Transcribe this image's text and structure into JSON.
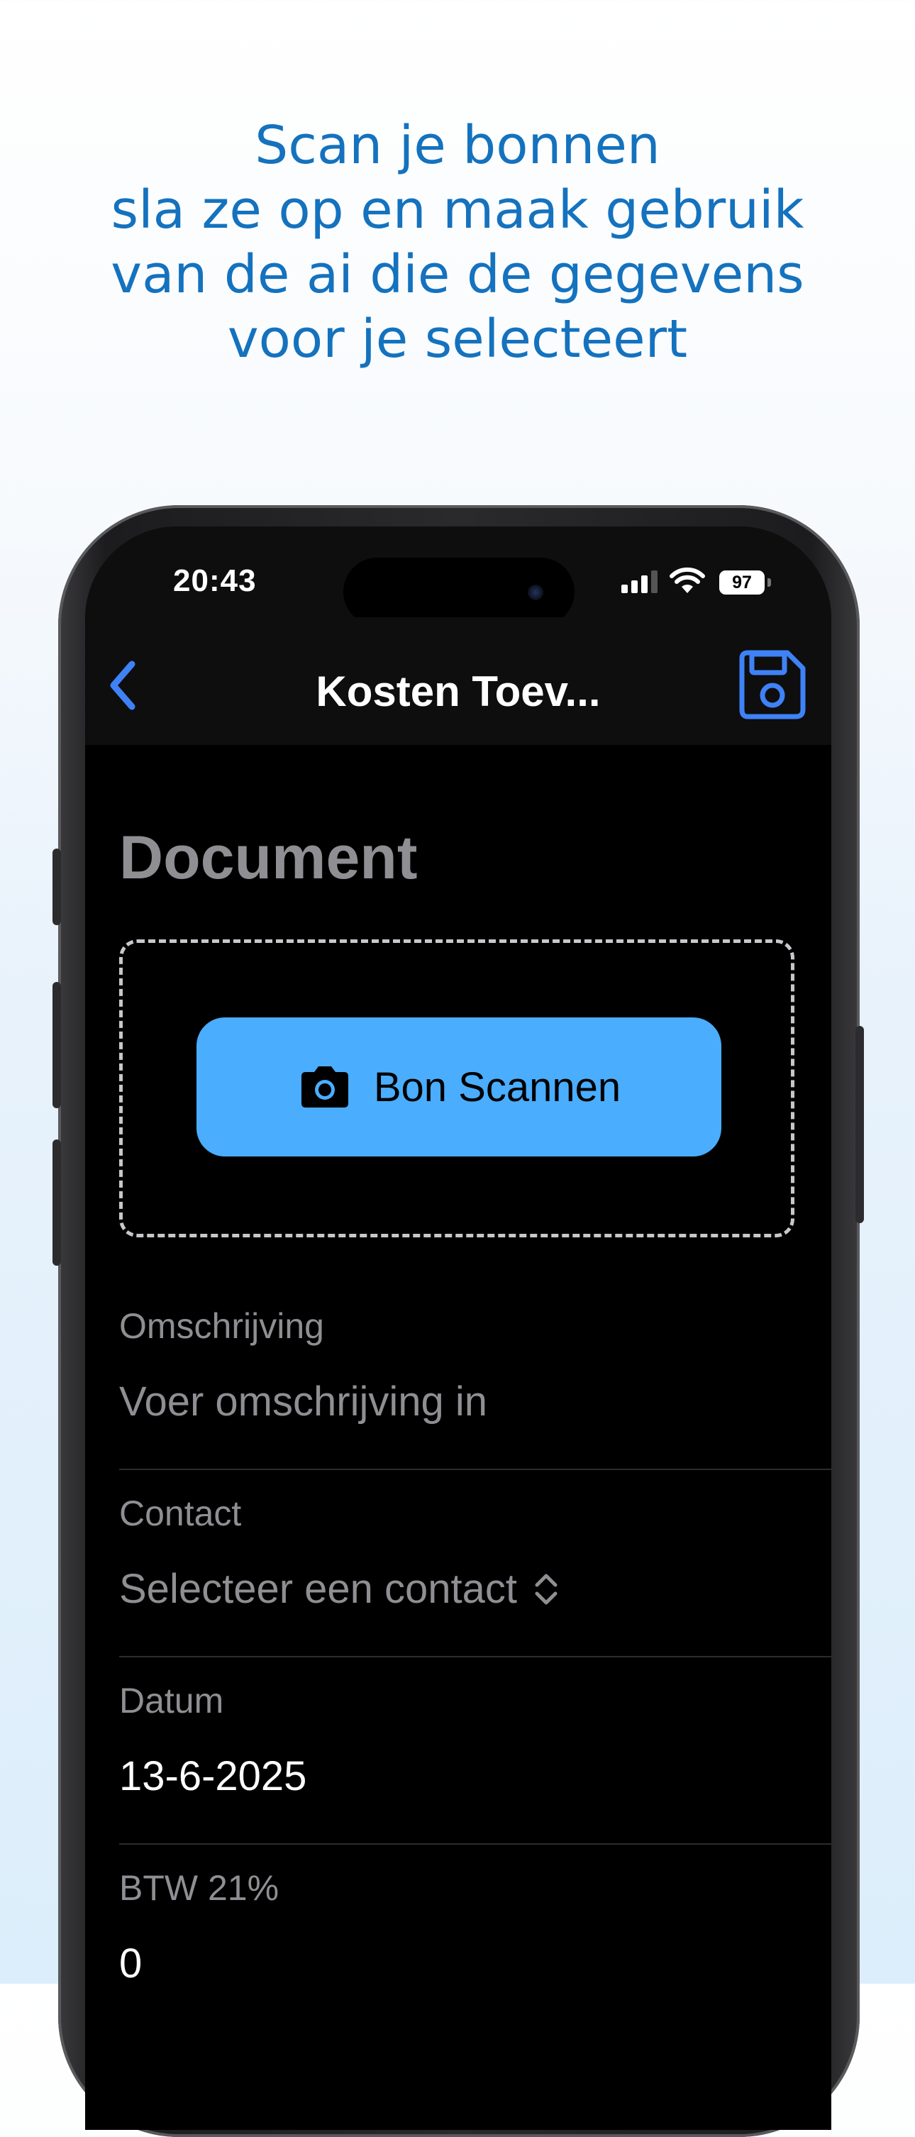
{
  "promo": {
    "lines": [
      "Scan je bonnen",
      "sla ze op en maak gebruik",
      "van de ai die de gegevens",
      "voor je selecteert"
    ]
  },
  "status_bar": {
    "time": "20:43",
    "battery": "97"
  },
  "navbar": {
    "title": "Kosten Toev..."
  },
  "document": {
    "section_title": "Document",
    "scan_button_label": "Bon Scannen"
  },
  "form": {
    "description": {
      "label": "Omschrijving",
      "placeholder": "Voer omschrijving in"
    },
    "contact": {
      "label": "Contact",
      "placeholder": "Selecteer een contact"
    },
    "date": {
      "label": "Datum",
      "value": "13-6-2025"
    },
    "vat": {
      "label": "BTW 21%",
      "value": "0"
    }
  },
  "colors": {
    "headline": "#1472be",
    "accent": "#4aadfe",
    "nav_icon": "#3f82f6",
    "screen_bg": "#000000",
    "muted": "#8e8e93"
  },
  "icons": {
    "back": "chevron-left-icon",
    "save": "floppy-disk-icon",
    "camera": "camera-icon",
    "select": "chevron-up-down-icon",
    "signal": "cellular-signal-icon",
    "wifi": "wifi-icon",
    "battery": "battery-icon"
  }
}
